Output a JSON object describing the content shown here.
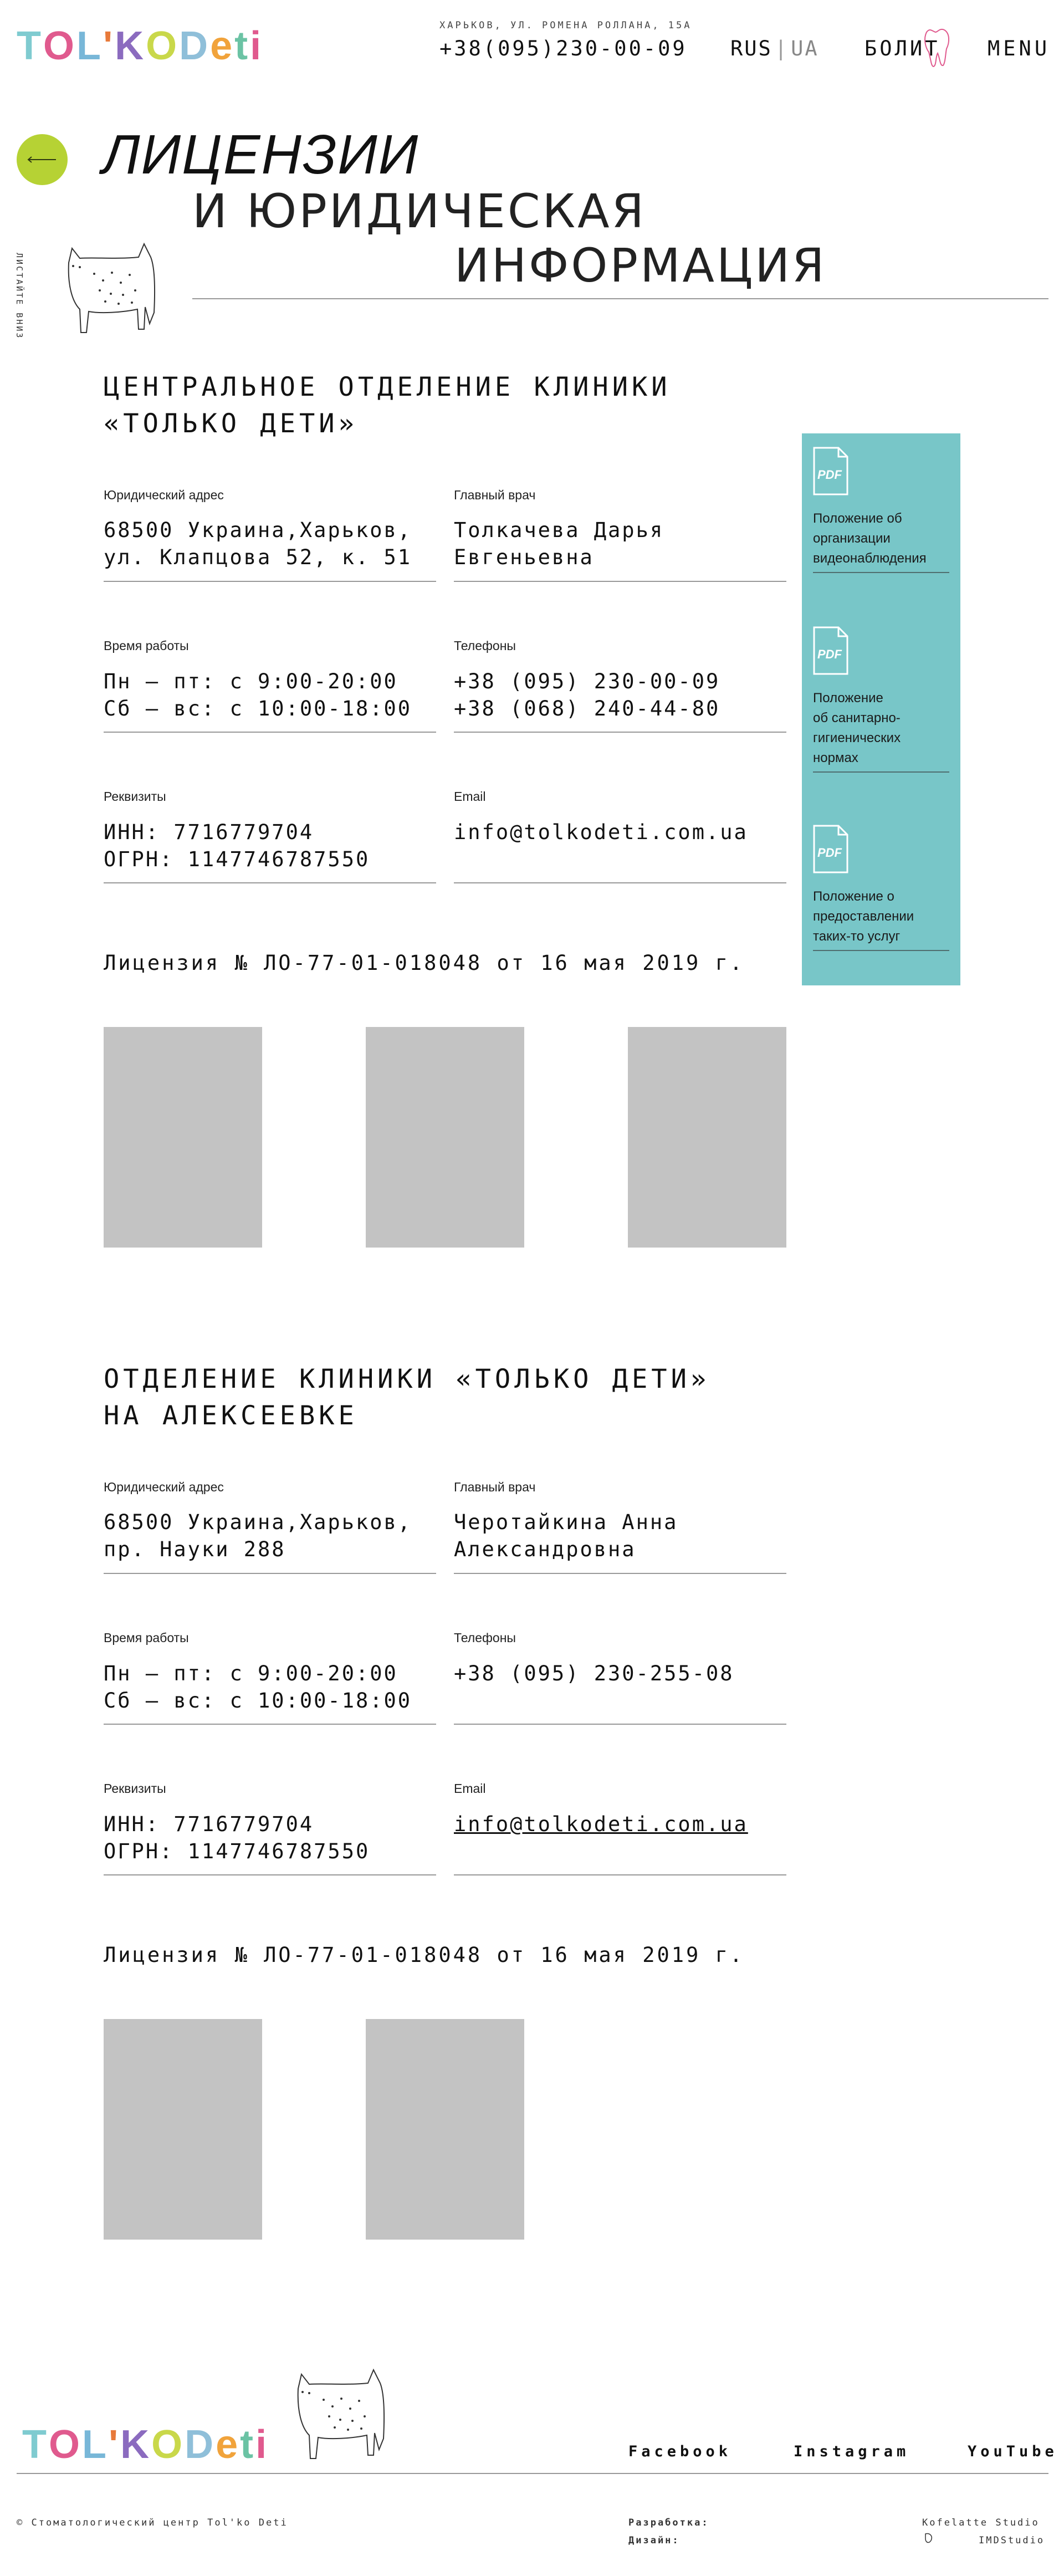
{
  "header": {
    "logo": [
      "T",
      "O",
      "L",
      "'",
      "K",
      "O",
      " ",
      "D",
      "e",
      "t",
      "i"
    ],
    "address": "ХАРЬКОВ, УЛ. РОМЕНА РОЛЛАНА, 15А",
    "phone": "+38(095)230-00-09",
    "lang_active": "RUS",
    "lang_sep": "|",
    "lang_inactive": "UA",
    "bolit": "БОЛИТ",
    "menu": "MENU"
  },
  "hero": {
    "title_line1": "ЛИЦЕНЗИИ",
    "title_line2": "И ЮРИДИЧЕСКАЯ",
    "title_line3": "ИНФОРМАЦИЯ",
    "scroll_hint": "ЛИСТАЙТЕ ВНИЗ"
  },
  "sections": [
    {
      "title": "ЦЕНТРАЛЬНОЕ ОТДЕЛЕНИЕ КЛИНИКИ\n«ТОЛЬКО ДЕТИ»",
      "address_label": "Юридический адрес",
      "address": "68500 Украина,Харьков,\nул. Клапцова 52, к. 51",
      "doctor_label": "Главный врач",
      "doctor": "Толкачева Дарья\nЕвгеньевна",
      "hours_label": "Время работы",
      "hours": "Пн – пт: с 9:00-20:00\nСб – вс: с 10:00-18:00",
      "phones_label": "Телефоны",
      "phones": "+38 (095) 230-00-09\n+38 (068) 240-44-80",
      "requisites_label": "Реквизиты",
      "requisites": "ИНН: 7716779704\nОГРН: 1147746787550",
      "email_label": "Email",
      "email": "info@tolkodeti.com.ua",
      "license": "Лицензия № ЛО-77-01-018048 от 16 мая 2019 г."
    },
    {
      "title": "ОТДЕЛЕНИЕ КЛИНИКИ «ТОЛЬКО ДЕТИ»\nНА АЛЕКСЕЕВКЕ",
      "address_label": "Юридический адрес",
      "address": "68500 Украина,Харьков,\nпр. Науки 288",
      "doctor_label": "Главный врач",
      "doctor": "Черотайкина Анна\nАлександровна",
      "hours_label": "Время работы",
      "hours": "Пн – пт: с 9:00-20:00\nСб – вс: с 10:00-18:00",
      "phones_label": "Телефоны",
      "phones": "+38 (095) 230-255-08",
      "requisites_label": "Реквизиты",
      "requisites": "ИНН: 7716779704\nОГРН: 1147746787550",
      "email_label": "Email",
      "email": "info@tolkodeti.com.ua",
      "license": "Лицензия № ЛО-77-01-018048 от 16 мая 2019 г."
    }
  ],
  "pdf_docs": [
    {
      "icon_text": "PDF",
      "name": "Положение об\nорганизации\nвидеонаблюдения"
    },
    {
      "icon_text": "PDF",
      "name": "Положение\nоб санитарно-\nгигиенических\nнормах"
    },
    {
      "icon_text": "PDF",
      "name": "Положение о\nпредоставлении\nтаких-то услуг"
    }
  ],
  "footer": {
    "social": [
      "Facebook",
      "Instagram",
      "YouTube"
    ],
    "copyright": "© Стоматологический центр Tol'ko Deti",
    "dev_label": "Разработка:",
    "design_label": "Дизайн:",
    "dev_studio": "Kofelatte Studio",
    "design_studio": "IMDStudio"
  },
  "colors": {
    "accent_green": "#b6d234",
    "panel_teal": "#78c6c8",
    "placeholder_gray": "#c3c3c3"
  }
}
